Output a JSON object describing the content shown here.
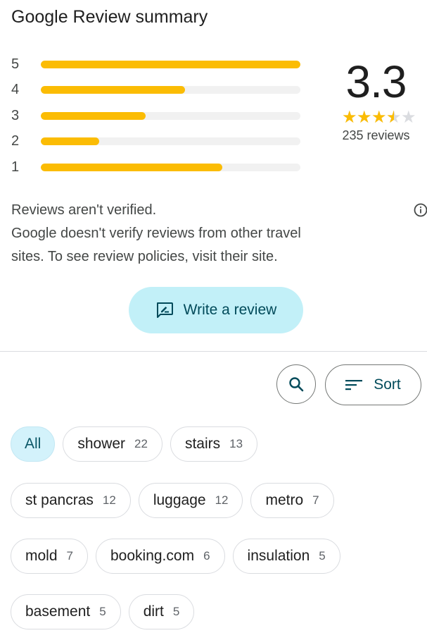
{
  "header": {
    "title": "Google Review summary"
  },
  "ratings": [
    {
      "stars": "5",
      "fraction": 1.0
    },
    {
      "stars": "4",
      "fraction": 0.555
    },
    {
      "stars": "3",
      "fraction": 0.405
    },
    {
      "stars": "2",
      "fraction": 0.225
    },
    {
      "stars": "1",
      "fraction": 0.7
    }
  ],
  "summary": {
    "score": "3.3",
    "star_value": 3.5,
    "review_count": "235 reviews"
  },
  "notice": {
    "heading": "Reviews aren't verified.",
    "line1": "Google doesn't verify reviews from other travel",
    "line2": "sites. To see review policies, visit their site."
  },
  "actions": {
    "write_review": "Write a review",
    "sort": "Sort"
  },
  "topics": [
    {
      "label": "All",
      "count": ""
    },
    {
      "label": "shower",
      "count": "22"
    },
    {
      "label": "stairs",
      "count": "13"
    },
    {
      "label": "st pancras",
      "count": "12"
    },
    {
      "label": "luggage",
      "count": "12"
    },
    {
      "label": "metro",
      "count": "7"
    },
    {
      "label": "mold",
      "count": "7"
    },
    {
      "label": "booking.com",
      "count": "6"
    },
    {
      "label": "insulation",
      "count": "5"
    },
    {
      "label": "basement",
      "count": "5"
    },
    {
      "label": "dirt",
      "count": "5"
    }
  ],
  "colors": {
    "star": "#fbbc04",
    "accent": "#004a5a",
    "button_bg": "#c2f0f8",
    "chip_active": "#d3f2fb"
  }
}
